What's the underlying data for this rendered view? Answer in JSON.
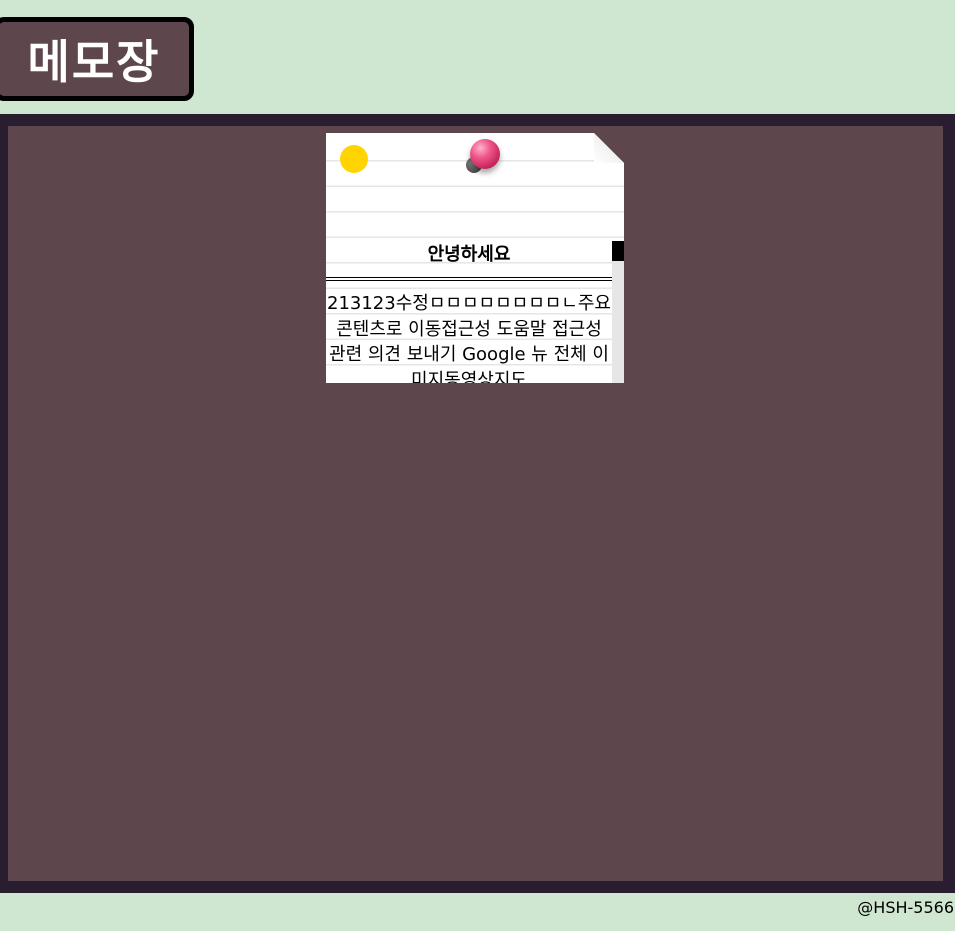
{
  "app": {
    "title": "메모장"
  },
  "memos": [
    {
      "title": "안녕하세요",
      "body": "213123수정ㅁㅁㅁㅁㅁㅁㅁㅁㄴ주요 콘텐츠로 이동접근성 도움말 접근성 관련 의견 보내기 Google 뉴 전체 이미지동영상지도"
    }
  ],
  "footer": {
    "credit": "@HSH-5566"
  },
  "colors": {
    "page_bg": "#cfe6d1",
    "board_frame": "#281e2f",
    "board_bg": "#5e474c",
    "title_box_bg": "#5e474c",
    "memo_dot": "#ffd400",
    "pin": "#e0407a"
  }
}
